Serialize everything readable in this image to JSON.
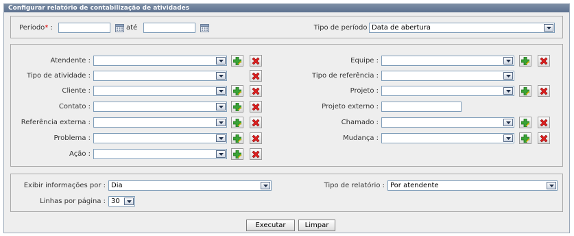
{
  "panel": {
    "title": "Configurar relatório de contabilização de atividades"
  },
  "period": {
    "label": "Período",
    "required_mark": "*",
    "colon": ":",
    "start_value": "",
    "between": "até",
    "end_value": "",
    "type_label": "Tipo de período :",
    "type_value": "Data de abertura"
  },
  "filters": {
    "attendant": {
      "label": "Atendente :",
      "value": ""
    },
    "activity_type": {
      "label": "Tipo de atividade :",
      "value": ""
    },
    "client": {
      "label": "Cliente :",
      "value": ""
    },
    "contact": {
      "label": "Contato :",
      "value": ""
    },
    "external_reference": {
      "label": "Referência externa :",
      "value": ""
    },
    "problem": {
      "label": "Problema :",
      "value": ""
    },
    "action": {
      "label": "Ação :",
      "value": ""
    },
    "team": {
      "label": "Equipe :",
      "value": ""
    },
    "reference_type": {
      "label": "Tipo de referência :",
      "value": ""
    },
    "project": {
      "label": "Projeto :",
      "value": ""
    },
    "external_project": {
      "label": "Projeto externo :",
      "value": ""
    },
    "ticket": {
      "label": "Chamado :",
      "value": ""
    },
    "change": {
      "label": "Mudança :",
      "value": ""
    }
  },
  "display": {
    "show_by_label": "Exibir informações por :",
    "show_by_value": "Dia",
    "report_type_label": "Tipo de relatório :",
    "report_type_value": "Por atendente",
    "rows_label": "Linhas por página :",
    "rows_value": "30"
  },
  "actions": {
    "run": "Executar",
    "clear": "Limpar"
  },
  "icons": {
    "add": "add-icon",
    "remove": "remove-icon",
    "calendar": "calendar-icon",
    "dropdown": "dropdown-arrow-icon"
  },
  "colors": {
    "title_bar": "#6a7d98",
    "required": "#e00000",
    "add": "#3aa336",
    "remove": "#e02020"
  }
}
